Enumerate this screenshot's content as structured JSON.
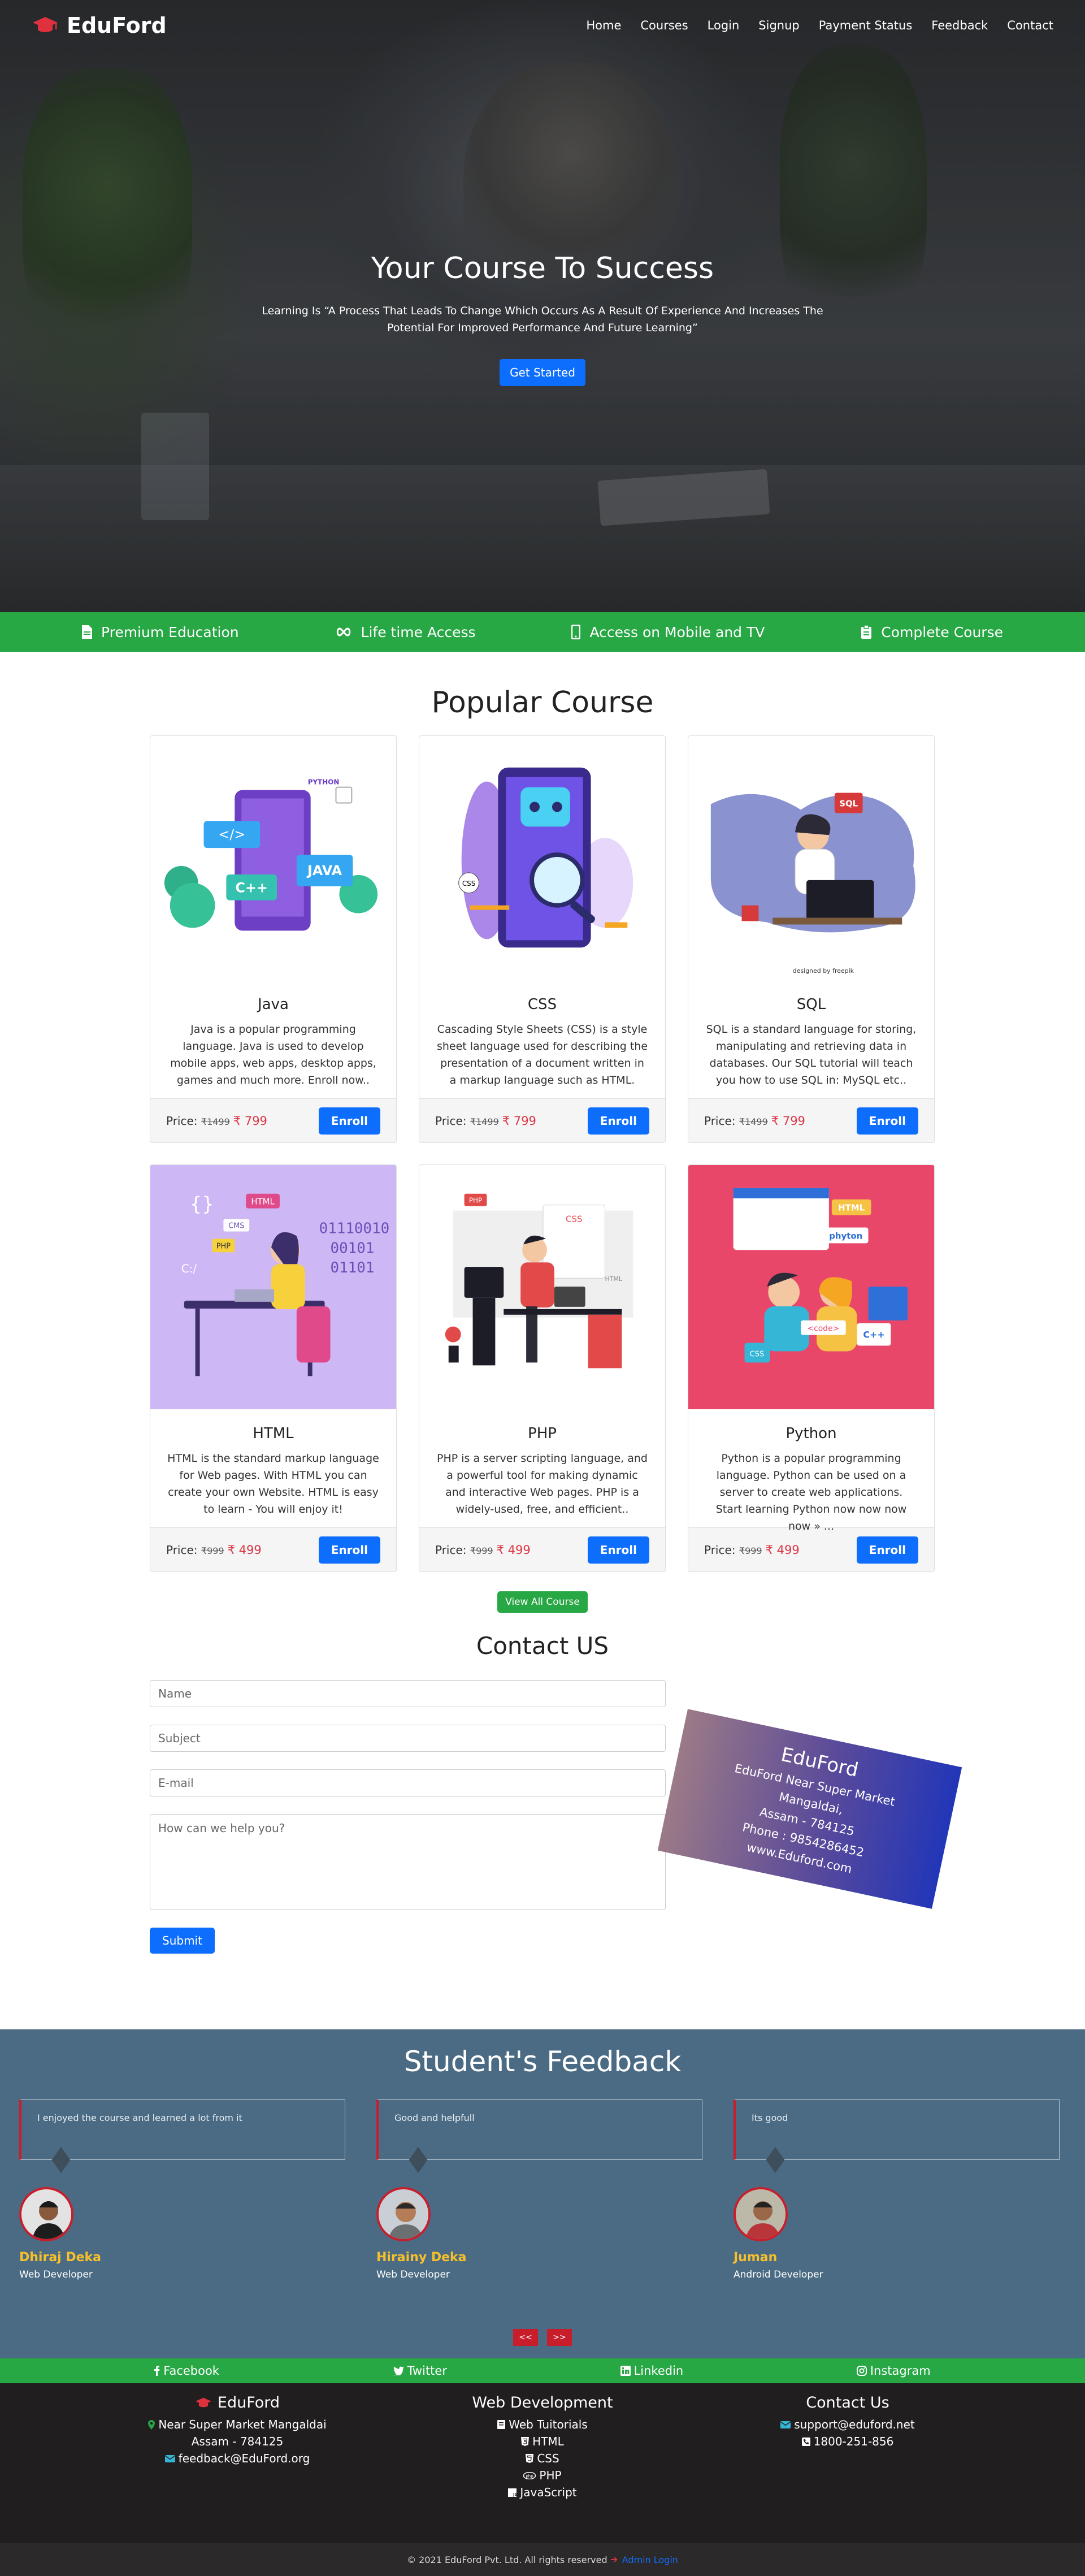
{
  "nav": {
    "brand": "EduFord",
    "links": [
      "Home",
      "Courses",
      "Login",
      "Signup",
      "Payment Status",
      "Feedback",
      "Contact"
    ]
  },
  "hero": {
    "title": "Your Course To Success",
    "subtitle": "Learning Is “A Process That Leads To Change Which Occurs As A Result Of Experience And Increases The Potential For Improved Performance And Future Learning”",
    "cta": "Get Started"
  },
  "features": [
    "Premium Education",
    "Life time Access",
    "Access on Mobile and TV",
    "Complete Course"
  ],
  "courses": {
    "title": "Popular Course",
    "price_label": "Price:",
    "enroll": "Enroll",
    "items": [
      {
        "name": "Java",
        "desc": "Java is a popular programming language. Java is used to develop mobile apps, web apps, desktop apps, games and much more. Enroll now..",
        "old": "₹1499",
        "new": "₹ 799"
      },
      {
        "name": "CSS",
        "desc": "Cascading Style Sheets (CSS) is a style sheet language used for describing the presentation of a document written in a markup language such as HTML.",
        "old": "₹1499",
        "new": "₹ 799"
      },
      {
        "name": "SQL",
        "desc": "SQL is a standard language for storing, manipulating and retrieving data in databases. Our SQL tutorial will teach you how to use SQL in: MySQL etc..",
        "old": "₹1499",
        "new": "₹ 799"
      },
      {
        "name": "HTML",
        "desc": "HTML is the standard markup language for Web pages. With HTML you can create your own Website. HTML is easy to learn - You will enjoy it!",
        "old": "₹999",
        "new": "₹ 499"
      },
      {
        "name": "PHP",
        "desc": "PHP is a server scripting language, and a powerful tool for making dynamic and interactive Web pages. PHP is a widely-used, free, and efficient..",
        "old": "₹999",
        "new": "₹ 499"
      },
      {
        "name": "Python",
        "desc": "Python is a popular programming language. Python can be used on a server to create web applications. Start learning Python now now now now » ...",
        "old": "₹999",
        "new": "₹ 499"
      }
    ],
    "view_all": "View All Course"
  },
  "contact": {
    "title": "Contact US",
    "name_ph": "Name",
    "subject_ph": "Subject",
    "email_ph": "E-mail",
    "message_ph": "How can we help you?",
    "submit": "Submit",
    "card": {
      "brand": "EduFord",
      "line1": "EduFord Near Super Market",
      "line2": "Mangaldai,",
      "line3": "Assam - 784125",
      "line4": "Phone : 9854286452",
      "line5": "www.Eduford.com"
    }
  },
  "feedback": {
    "title": "Student's Feedback",
    "items": [
      {
        "quote": "I enjoyed the course and learned a lot from it",
        "name": "Dhiraj Deka",
        "role": "Web Developer"
      },
      {
        "quote": "Good and helpfull",
        "name": "Hirainy Deka",
        "role": "Web Developer"
      },
      {
        "quote": "Its good",
        "name": "Juman",
        "role": "Android Developer"
      }
    ],
    "prev": "<<",
    "next": ">>"
  },
  "social": [
    "Facebook",
    "Twitter",
    "Linkedin",
    "Instagram"
  ],
  "footer": {
    "col1": {
      "title": "EduFord",
      "addr1": "Near Super Market Mangaldai",
      "addr2": "Assam - 784125",
      "email": "feedback@EduFord.org"
    },
    "col2": {
      "title": "Web Development",
      "items": [
        "Web Tuitorials",
        "HTML",
        "CSS",
        "PHP",
        "JavaScript"
      ]
    },
    "col3": {
      "title": "Contact Us",
      "email": "support@eduford.net",
      "phone": "1800-251-856"
    },
    "copyright": "© 2021 EduFord Pvt. Ltd. All rights reserved",
    "admin": "Admin Login"
  },
  "colors": {
    "primary": "#0d6efd",
    "success": "#28a745",
    "danger": "#dc3545",
    "feedback_bg": "#4a6b83",
    "footer_bg": "#211e20"
  }
}
